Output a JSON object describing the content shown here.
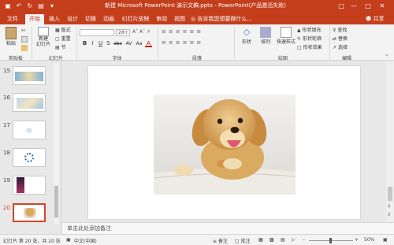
{
  "title": "新建 Microsoft PowerPoint 演示文稿.pptx - PowerPoint(产品激活失败)",
  "share_label": "共享",
  "tell_me": "告诉我您想要做什么...",
  "tabs": [
    "文件",
    "开始",
    "插入",
    "设计",
    "切换",
    "动画",
    "幻灯片放映",
    "审阅",
    "视图"
  ],
  "ribbon": {
    "clipboard": {
      "paste": "粘贴",
      "group": "剪贴板"
    },
    "slides": {
      "new_slide": "新建\n幻灯片",
      "layout": "版式",
      "reset": "重置",
      "section": "节",
      "group": "幻灯片"
    },
    "font": {
      "size": "28+",
      "group": "字体",
      "buttons": [
        "B",
        "I",
        "U",
        "S",
        "abc",
        "AV",
        "Aa",
        "A"
      ]
    },
    "paragraph": {
      "group": "段落"
    },
    "drawing": {
      "shapes": "形状",
      "arrange": "排列",
      "quick_styles": "快速样式",
      "fill": "形状填充",
      "outline": "形状轮廓",
      "effects": "形状效果",
      "group": "绘图"
    },
    "editing": {
      "find": "查找",
      "replace": "替换",
      "select": "选择",
      "group": "编辑"
    }
  },
  "slides": [
    {
      "num": "15",
      "selected": false
    },
    {
      "num": "16",
      "selected": false
    },
    {
      "num": "17",
      "selected": false
    },
    {
      "num": "18",
      "selected": false
    },
    {
      "num": "19",
      "selected": false
    },
    {
      "num": "20",
      "selected": true
    }
  ],
  "notes_placeholder": "单击此处添加备注",
  "status": {
    "slide_info": "幻灯片 第 20 张，共 20 张",
    "language": "中文(中国)",
    "notes": "备注",
    "comments": "批注",
    "zoom": "50%"
  },
  "colors": {
    "accent": "#c43e1c",
    "selected_thumb": "#d24726"
  }
}
